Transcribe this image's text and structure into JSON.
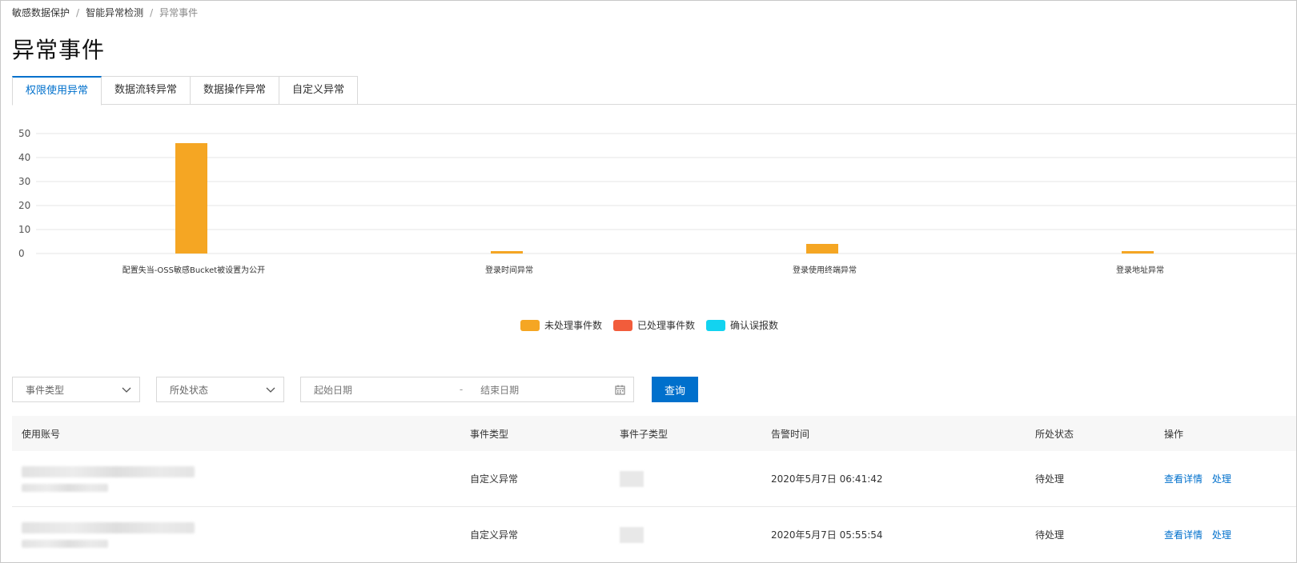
{
  "breadcrumb": [
    "敏感数据保护",
    "智能异常检测",
    "异常事件"
  ],
  "page_title": "异常事件",
  "tabs": [
    "权限使用异常",
    "数据流转异常",
    "数据操作异常",
    "自定义异常"
  ],
  "active_tab": 0,
  "chart_data": {
    "type": "bar",
    "categories": [
      "配置失当-OSS敏感Bucket被设置为公开",
      "登录时间异常",
      "登录使用终端异常",
      "登录地址异常"
    ],
    "series": [
      {
        "name": "未处理事件数",
        "values": [
          46,
          1,
          4,
          1
        ],
        "color": "#f5a623"
      },
      {
        "name": "已处理事件数",
        "values": [
          0,
          0,
          0,
          0
        ],
        "color": "#f25c3b"
      },
      {
        "name": "确认误报数",
        "values": [
          0,
          0,
          0,
          0
        ],
        "color": "#12d3f0"
      }
    ],
    "yticks": [
      0,
      10,
      20,
      30,
      40,
      50
    ],
    "ylim": [
      0,
      50
    ],
    "grid": true,
    "legend_position": "bottom-center"
  },
  "filters": {
    "event_type_placeholder": "事件类型",
    "status_placeholder": "所处状态",
    "start_date_placeholder": "起始日期",
    "date_separator": "-",
    "end_date_placeholder": "结束日期",
    "query_label": "查询"
  },
  "table": {
    "headers": [
      "使用账号",
      "事件类型",
      "事件子类型",
      "告警时间",
      "所处状态",
      "操作"
    ],
    "rows": [
      {
        "event_type": "自定义异常",
        "alert_time": "2020年5月7日 06:41:42",
        "status": "待处理",
        "action_detail": "查看详情",
        "action_handle": "处理"
      },
      {
        "event_type": "自定义异常",
        "alert_time": "2020年5月7日 05:55:54",
        "status": "待处理",
        "action_detail": "查看详情",
        "action_handle": "处理"
      }
    ]
  }
}
